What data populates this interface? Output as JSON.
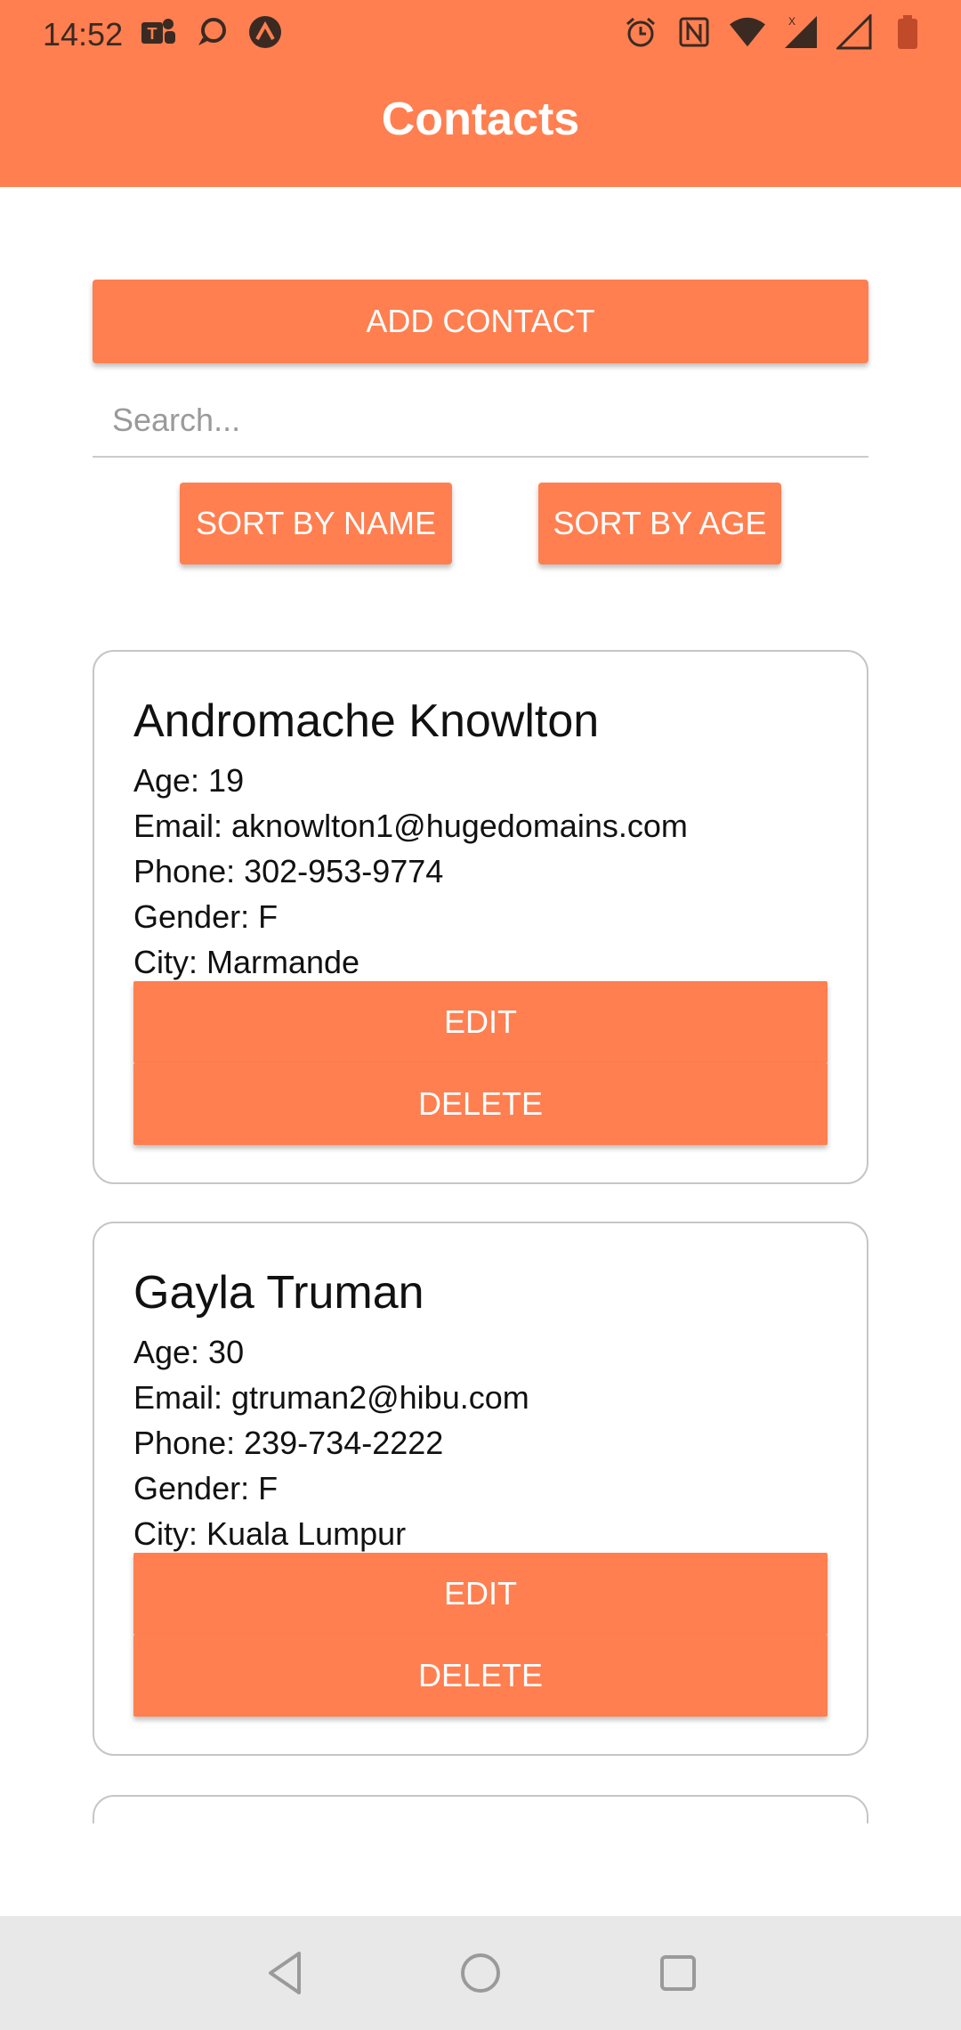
{
  "status_bar": {
    "time": "14:52",
    "left_icons": [
      "teams-icon",
      "chat-bubble-icon",
      "expo-icon"
    ],
    "right_icons": [
      "alarm-icon",
      "nfc-icon",
      "wifi-icon",
      "signal-icon",
      "signal-empty-icon",
      "battery-icon"
    ]
  },
  "app_bar": {
    "title": "Contacts",
    "color": "#ff7f50"
  },
  "actions": {
    "add_label": "ADD CONTACT",
    "search_placeholder": "Search...",
    "sort_name_label": "SORT BY NAME",
    "sort_age_label": "SORT BY AGE"
  },
  "contacts": [
    {
      "name": "Andromache Knowlton",
      "age": "Age: 19",
      "email": "Email: aknowlton1@hugedomains.com",
      "phone": "Phone: 302-953-9774",
      "gender": "Gender: F",
      "city": "City: Marmande",
      "edit_label": "EDIT",
      "delete_label": "DELETE"
    },
    {
      "name": "Gayla Truman",
      "age": "Age: 30",
      "email": "Email: gtruman2@hibu.com",
      "phone": "Phone: 239-734-2222",
      "gender": "Gender: F",
      "city": "City: Kuala Lumpur",
      "edit_label": "EDIT",
      "delete_label": "DELETE"
    }
  ],
  "nav_bar": {
    "icons": [
      "back-icon",
      "home-icon",
      "recents-icon"
    ]
  }
}
